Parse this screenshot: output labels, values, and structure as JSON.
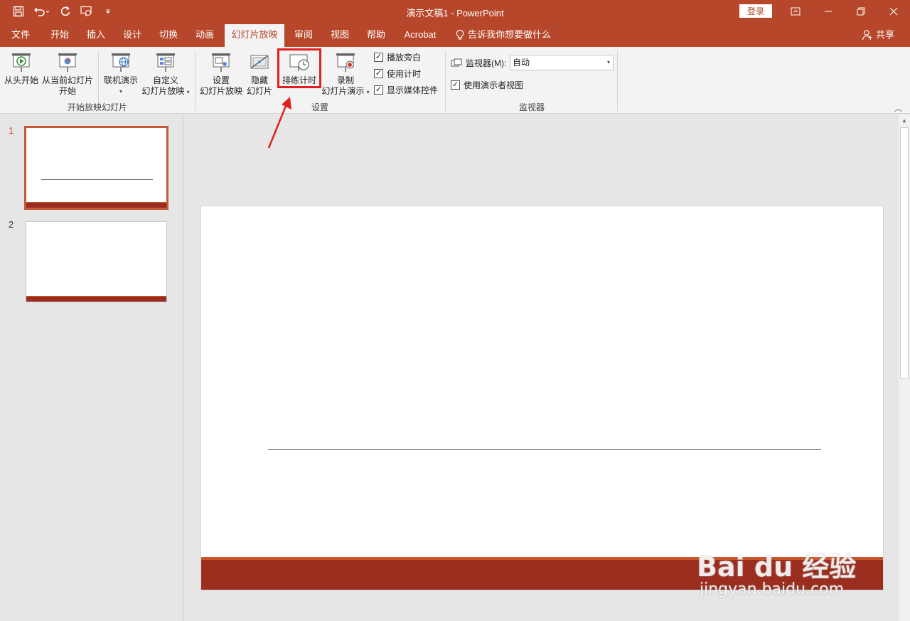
{
  "window": {
    "title": "演示文稿1  -  PowerPoint",
    "login_label": "登录"
  },
  "tabs": [
    "文件",
    "开始",
    "插入",
    "设计",
    "切换",
    "动画",
    "幻灯片放映",
    "审阅",
    "视图",
    "帮助",
    "Acrobat"
  ],
  "active_tab": "幻灯片放映",
  "tell_me": "告诉我你想要做什么",
  "share": "共享",
  "ribbon": {
    "start_group": {
      "label": "开始放映幻灯片",
      "from_beginning": "从头开始",
      "from_current_1": "从当前幻灯片",
      "from_current_2": "开始",
      "online_present": "联机演示",
      "custom_1": "自定义",
      "custom_2": "幻灯片放映"
    },
    "setup_group": {
      "label": "设置",
      "setup_show_1": "设置",
      "setup_show_2": "幻灯片放映",
      "hide_slide_1": "隐藏",
      "hide_slide_2": "幻灯片",
      "rehearse": "排练计时",
      "record_1": "录制",
      "record_2": "幻灯片演示",
      "play_narrations": "播放旁白",
      "use_timings": "使用计时",
      "show_media_controls": "显示媒体控件"
    },
    "monitor_group": {
      "label": "监视器",
      "monitor_label": "监视器(M):",
      "monitor_value": "自动",
      "presenter_view": "使用演示者视图"
    }
  },
  "slides": [
    {
      "number": "1",
      "selected": true
    },
    {
      "number": "2",
      "selected": false
    }
  ],
  "colors": {
    "accent": "#b7472a",
    "slide_band": "#9b2d1f",
    "slide_band_top": "#c9572e",
    "highlight": "#e0201f"
  },
  "watermark": {
    "logo": "Bai du 经验",
    "url": "jingyan.baidu.com"
  }
}
